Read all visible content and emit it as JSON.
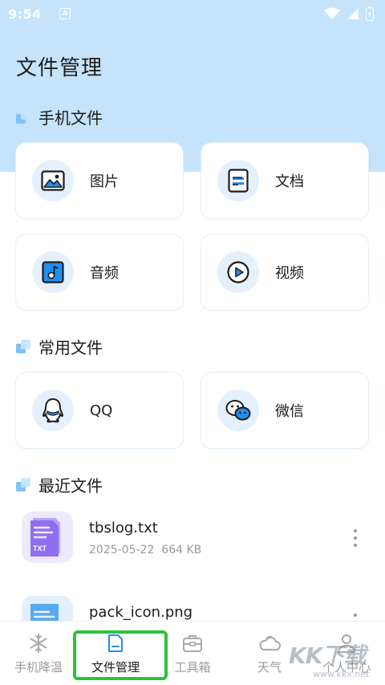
{
  "status_bar": {
    "time": "9:54",
    "badge": "A"
  },
  "page_title": "文件管理",
  "sections": {
    "phone_files": "手机文件",
    "common_files": "常用文件",
    "recent_files": "最近文件"
  },
  "phone_cards": [
    {
      "label": "图片",
      "icon": "image-icon"
    },
    {
      "label": "文档",
      "icon": "document-icon"
    },
    {
      "label": "音频",
      "icon": "audio-icon"
    },
    {
      "label": "视频",
      "icon": "video-icon"
    }
  ],
  "common_cards": [
    {
      "label": "QQ",
      "icon": "qq-icon"
    },
    {
      "label": "微信",
      "icon": "wechat-icon"
    }
  ],
  "recent_files": [
    {
      "name": "tbslog.txt",
      "date": "2025-05-22",
      "size": "664 KB",
      "badge": "TXT"
    },
    {
      "name": "pack_icon.png",
      "date": "",
      "size": ""
    }
  ],
  "nav": [
    {
      "label": "手机降温",
      "icon": "snowflake-icon"
    },
    {
      "label": "文件管理",
      "icon": "file-icon",
      "active": true
    },
    {
      "label": "工具箱",
      "icon": "toolbox-icon"
    },
    {
      "label": "天气",
      "icon": "cloud-icon"
    },
    {
      "label": "个人中心",
      "icon": "person-icon"
    }
  ],
  "watermark": {
    "big": "KK下载",
    "small": "www.kkx.net"
  },
  "colors": {
    "header_bg": "#c5e3fb",
    "accent": "#1e8ff0",
    "icon_circle": "#e4f1fc",
    "txt_thumb": "#8e6ff0",
    "png_thumb": "#5aa9f0",
    "highlight": "#2ec23a"
  }
}
